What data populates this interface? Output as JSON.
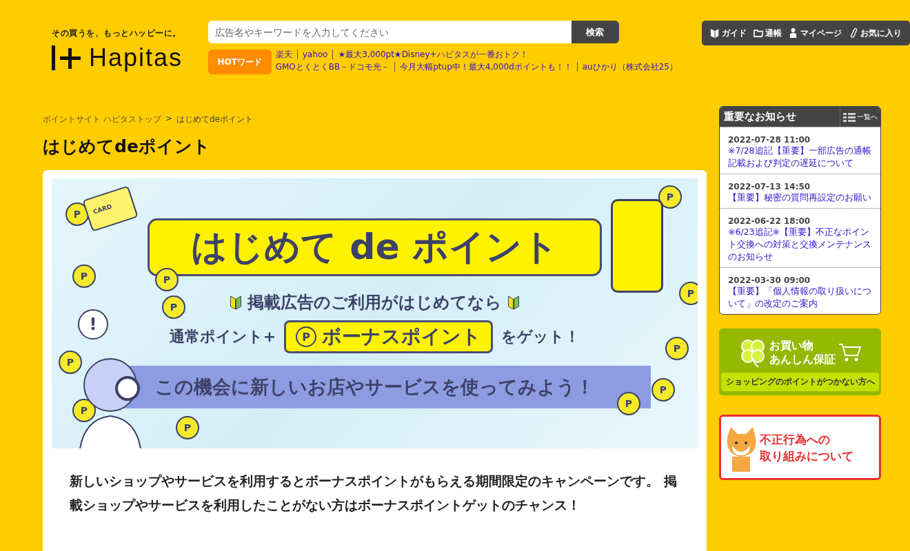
{
  "header": {
    "tagline": "その買うを、もっとハッピーに。",
    "logo": "Hapitas",
    "search": {
      "placeholder": "広告名やキーワードを入力してください",
      "button": "検索"
    },
    "nav": [
      {
        "label": "ガイド"
      },
      {
        "label": "通帳"
      },
      {
        "label": "マイページ"
      },
      {
        "label": "お気に入り"
      }
    ],
    "hot_label": "HOTワード",
    "hot_lines": [
      [
        "楽天",
        "yahoo",
        "★最大3,000pt★Disney+ハピタスが一番おトク！"
      ],
      [
        "GMOとくとくBB－ドコモ光－",
        "今月大幅ptup中！最大4,000dポイントも！！",
        "auひかり（株式会社25）"
      ]
    ]
  },
  "breadcrumb": [
    {
      "label": "ポイントサイト ハピタストップ",
      "link": true
    },
    {
      "label": "はじめてdeポイント",
      "link": false
    }
  ],
  "breadcrumb_sep": ">",
  "title": "はじめてdeポイント",
  "banner": {
    "title": "はじめて de ポイント",
    "subtitle": "掲載広告のご利用がはじめてなら",
    "line_before": "通常ポイント+",
    "bonus": "ボーナスポイント",
    "line_after": "をゲット！",
    "band": "この機会に新しいお店やサービスを使ってみよう！",
    "card_label": "CARD",
    "point_mark": "P",
    "coins": [
      "P",
      "P",
      "P",
      "P",
      "P",
      "P",
      "P",
      "P",
      "P",
      "P",
      "P",
      "P"
    ],
    "alert_mark": "!"
  },
  "intro": "新しいショップやサービスを利用するとボーナスポイントがもらえる期間限定のキャンペーンです。 掲載ショップやサービスを利用したことがない方はボーナスポイントゲットのチャンス！",
  "notices": {
    "title": "重要なお知らせ",
    "list_link": "一覧へ",
    "items": [
      {
        "date": "2022-07-28 11:00",
        "text": "※7/28追記【重要】一部広告の通帳記載および判定の遅延について"
      },
      {
        "date": "2022-07-13 14:50",
        "text": "【重要】秘密の質問再設定のお願い"
      },
      {
        "date": "2022-06-22 18:00",
        "text": "※6/23追記※【重要】不正なポイント交換への対策と交換メンテナンスのお知らせ"
      },
      {
        "date": "2022-03-30 09:00",
        "text": "【重要】「個人情報の取り扱いについて」の改定のご案内"
      }
    ]
  },
  "promos": [
    {
      "kind": "shopping",
      "title_lines": [
        "お買い物",
        "あんしん保証"
      ],
      "sub": "ショッピングのポイントがつかない方へ"
    },
    {
      "kind": "fraud",
      "title_lines": [
        "不正行為への",
        "取り組みについて"
      ]
    }
  ]
}
